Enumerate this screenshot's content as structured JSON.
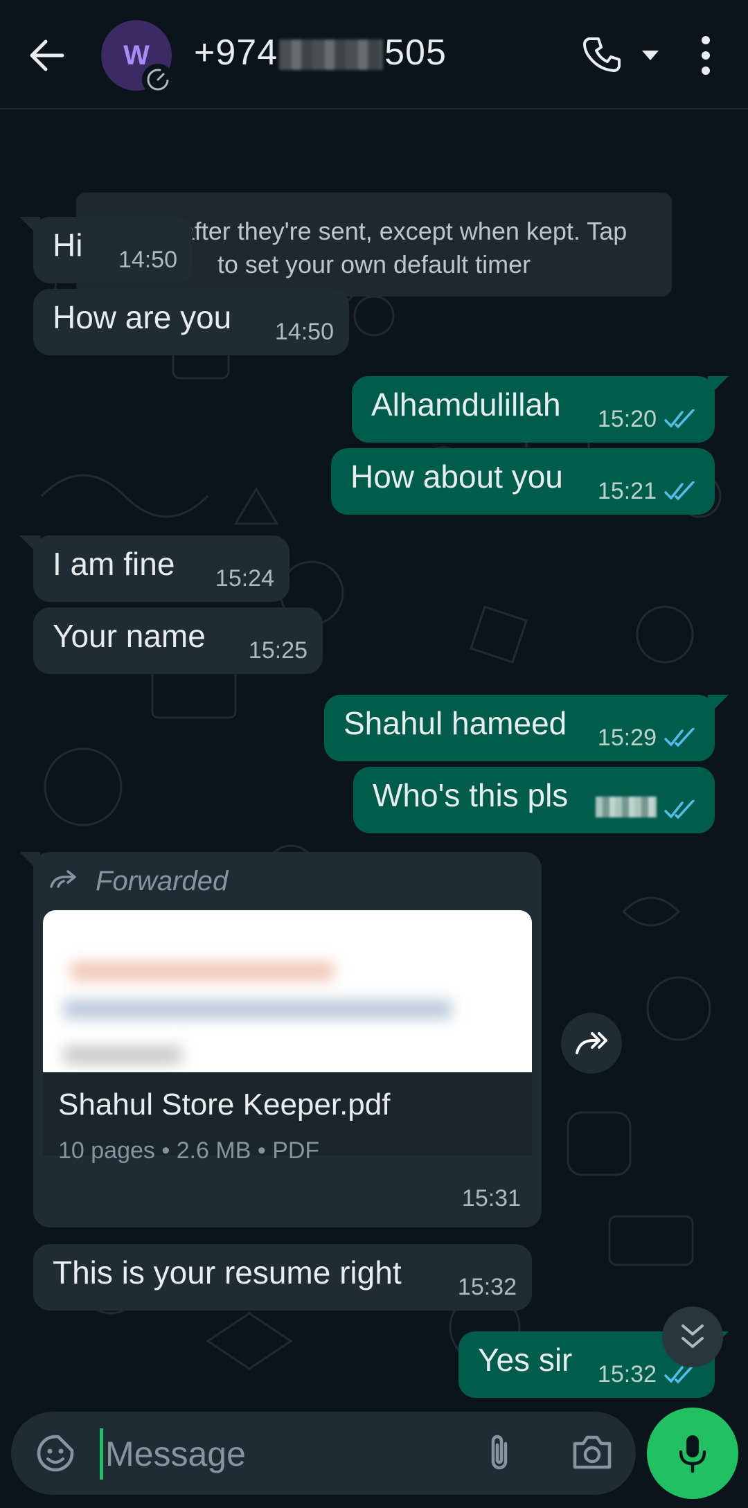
{
  "header": {
    "avatar_letter": "W",
    "contact_prefix": "+974",
    "contact_suffix": "505"
  },
  "system_message": {
    "line1": "days after they're sent, except when kept. Tap",
    "line2": "to set your own default timer"
  },
  "messages": [
    {
      "direction": "in",
      "text": "Hi",
      "time": "14:50"
    },
    {
      "direction": "in",
      "text": "How are you",
      "time": "14:50"
    },
    {
      "direction": "out",
      "text": "Alhamdulillah",
      "time": "15:20",
      "status": "read"
    },
    {
      "direction": "out",
      "text": "How about you",
      "time": "15:21",
      "status": "read"
    },
    {
      "direction": "in",
      "text": "I am fine",
      "time": "15:24"
    },
    {
      "direction": "in",
      "text": "Your name",
      "time": "15:25"
    },
    {
      "direction": "out",
      "text": "Shahul hameed",
      "time": "15:29",
      "status": "read"
    },
    {
      "direction": "out",
      "text": "Who's this pls",
      "time": "",
      "status": "read"
    },
    {
      "direction": "in",
      "text": "This is your resume right",
      "time": "15:32"
    },
    {
      "direction": "out",
      "text": "Yes sir",
      "time": "15:32",
      "status": "read"
    }
  ],
  "document_message": {
    "forwarded_label": "Forwarded",
    "file_name": "Shahul Store Keeper.pdf",
    "meta": "10 pages • 2.6 MB • PDF",
    "time": "15:31"
  },
  "composer": {
    "placeholder": "Message"
  },
  "icons": {
    "back": "arrow-left-icon",
    "call": "phone-icon",
    "more": "dots-vertical-icon",
    "emoji": "sticker-emoji-icon",
    "attach": "paperclip-icon",
    "camera": "camera-icon",
    "mic": "microphone-icon",
    "share": "forward-icon",
    "scroll": "double-chevron-down-icon"
  },
  "colors": {
    "background": "#0b141a",
    "incoming_bubble": "#1f2c33",
    "outgoing_bubble": "#005c4b",
    "accent": "#21c063",
    "read_ticks": "#53bdeb"
  }
}
